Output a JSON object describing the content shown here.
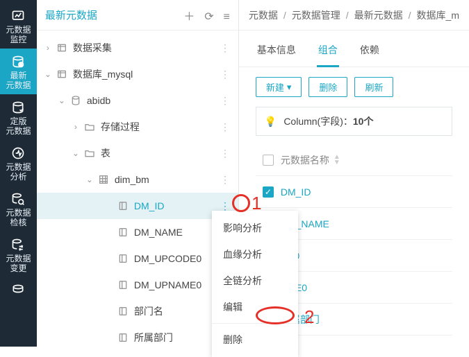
{
  "vnav": [
    {
      "label": "元数据\n监控",
      "icon": "monitor"
    },
    {
      "label": "最新\n元数据",
      "icon": "db-new",
      "active": true
    },
    {
      "label": "定版\n元数据",
      "icon": "db-ver"
    },
    {
      "label": "元数据\n分析",
      "icon": "analysis"
    },
    {
      "label": "元数据\n检核",
      "icon": "audit"
    },
    {
      "label": "元数据\n变更",
      "icon": "change"
    },
    {
      "label": "",
      "icon": "more"
    }
  ],
  "tree_header": {
    "title": "最新元数据",
    "actions": [
      "＋",
      "⟳",
      "≡"
    ]
  },
  "tree": [
    {
      "depth": 0,
      "expander": "›",
      "icon": "folder",
      "label": "数据采集"
    },
    {
      "depth": 0,
      "expander": "⌄",
      "icon": "folder",
      "label": "数据库_mysql"
    },
    {
      "depth": 1,
      "expander": "⌄",
      "icon": "db",
      "label": "abidb"
    },
    {
      "depth": 2,
      "expander": "›",
      "icon": "folderline",
      "label": "存储过程"
    },
    {
      "depth": 2,
      "expander": "⌄",
      "icon": "folderline",
      "label": "表"
    },
    {
      "depth": 3,
      "expander": "⌄",
      "icon": "grid",
      "label": "dim_bm"
    },
    {
      "depth": 4,
      "expander": "",
      "icon": "col",
      "label": "DM_ID",
      "selected": true
    },
    {
      "depth": 4,
      "expander": "",
      "icon": "col",
      "label": "DM_NAME"
    },
    {
      "depth": 4,
      "expander": "",
      "icon": "col",
      "label": "DM_UPCODE0"
    },
    {
      "depth": 4,
      "expander": "",
      "icon": "col",
      "label": "DM_UPNAME0"
    },
    {
      "depth": 4,
      "expander": "",
      "icon": "col",
      "label": "部门名"
    },
    {
      "depth": 4,
      "expander": "",
      "icon": "col",
      "label": "所属部门"
    }
  ],
  "breadcrumbs": [
    "元数据",
    "元数据管理",
    "最新元数据",
    "数据库_m"
  ],
  "tabs": [
    {
      "label": "基本信息"
    },
    {
      "label": "组合",
      "active": true
    },
    {
      "label": "依赖"
    }
  ],
  "toolbar": {
    "new": "新建",
    "delete": "删除",
    "refresh": "刷新"
  },
  "info": {
    "prefix": "Column(字段)：",
    "count": "10个"
  },
  "table": {
    "header": "元数据名称",
    "rows": [
      {
        "name": "DM_ID",
        "checked": true
      },
      {
        "name": "DM_NAME",
        "checked": true
      },
      {
        "name": "DE0",
        "checked": false,
        "partial": true
      },
      {
        "name": "AME0",
        "checked": false,
        "partial": true
      },
      {
        "name": "所属部门",
        "checked": false,
        "partial": true
      }
    ]
  },
  "context_menu": [
    "影响分析",
    "血缘分析",
    "全链分析",
    "编辑",
    "删除"
  ],
  "annotations": {
    "label1": "1",
    "label2": "2"
  }
}
